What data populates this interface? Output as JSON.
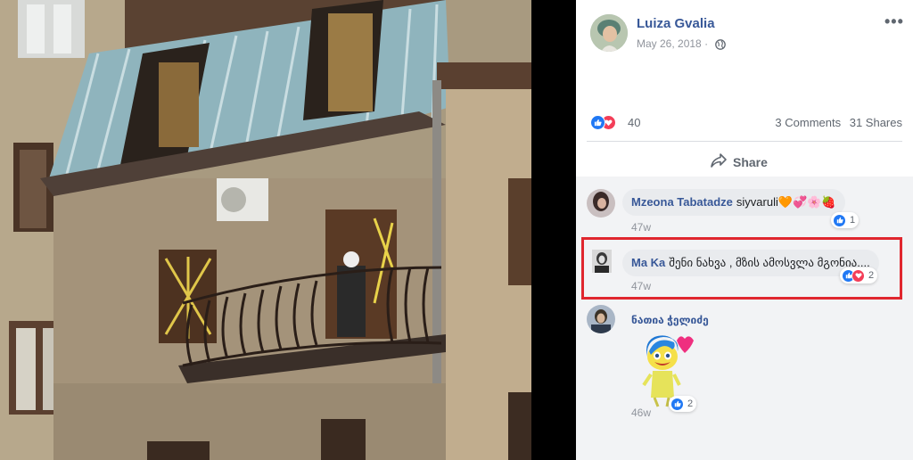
{
  "post": {
    "author": "Luiza Gvalia",
    "date": "May 26, 2018",
    "date_separator": "·",
    "more_label": "•••",
    "reaction_count": "40",
    "comments_label": "3 Comments",
    "shares_label": "31 Shares",
    "share_button_label": "Share"
  },
  "comments": [
    {
      "name": "Mzeona Tabatadze",
      "text": "siyvaruli🧡💞🌸🍓",
      "time": "47w",
      "reaction_count": "1",
      "reactions": [
        "like"
      ]
    },
    {
      "name": "Ma Ka",
      "text": "შენი ნახვა , მზის ამოსვლა მგონია....",
      "time": "47w",
      "reaction_count": "2",
      "reactions": [
        "like",
        "love"
      ]
    },
    {
      "name": "ნათია ჭელიძე",
      "text": "",
      "time": "46w",
      "reaction_count": "2",
      "reactions": [
        "like"
      ],
      "sticker": "joy-heart-sticker"
    }
  ],
  "colors": {
    "link_blue": "#385898",
    "like_blue": "#2078f4",
    "love_red": "#f33e58",
    "highlight_red": "#e0262e",
    "bubble_gray": "#e9ebee"
  },
  "icons": {
    "globe": "globe-icon",
    "share": "share-arrow-icon",
    "like": "like-icon",
    "love": "love-icon"
  }
}
